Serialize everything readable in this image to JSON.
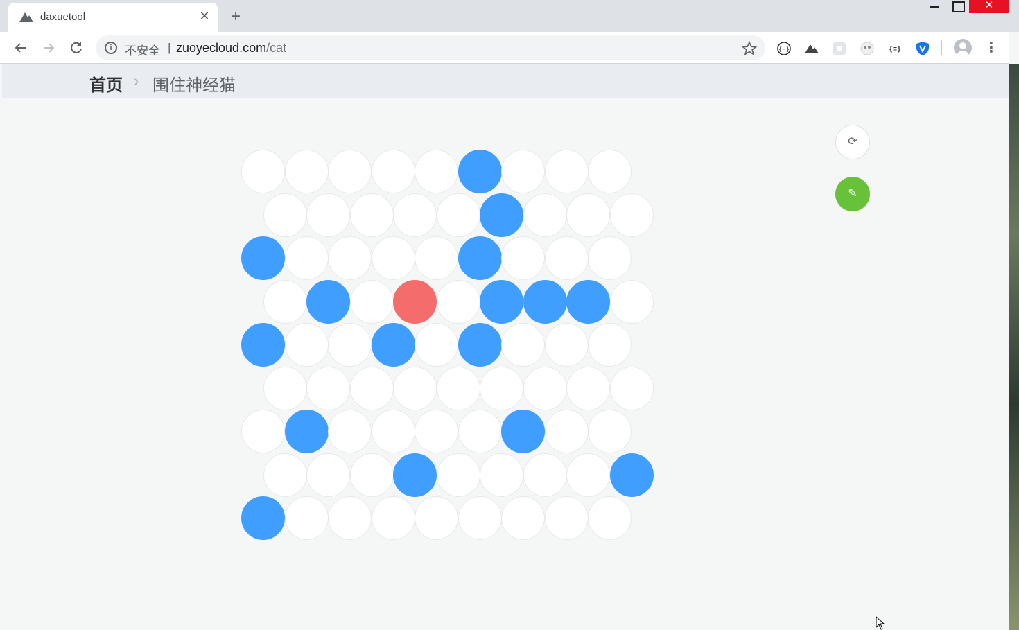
{
  "browser": {
    "tab_title": "daxuetool",
    "tab_close": "✕",
    "new_tab": "+",
    "window_close": "✕",
    "security_label": "不安全",
    "separator": "|",
    "url_host": "zuoyecloud.com",
    "url_path": "/cat",
    "icons": {
      "back": "back-arrow-icon",
      "forward": "forward-arrow-icon",
      "reload": "reload-icon",
      "bookmark": "star-icon",
      "menu": "more-vert-icon"
    }
  },
  "breadcrumb": {
    "home": "首页",
    "separator": "›",
    "current": "围住神经猫"
  },
  "game": {
    "rows": [
      "00000W000",
      "00000W000",
      "W0000W000",
      "0W0C0WWW0",
      "W00W0W000",
      "000000000",
      "0W0000W00",
      "000W0000W",
      "W00000000"
    ],
    "legend": {
      "0": "empty",
      "W": "wall",
      "C": "cat"
    },
    "colors": {
      "empty": "#ffffff",
      "wall": "#409eff",
      "cat": "#f56c6c",
      "edit_button": "#67c23a"
    }
  },
  "controls": {
    "refresh_icon": "⟳",
    "edit_icon": "✎"
  }
}
